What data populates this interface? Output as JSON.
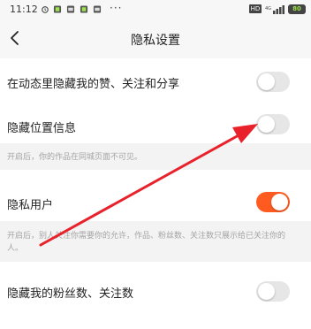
{
  "status_bar": {
    "time": "11:12",
    "more": "···",
    "network": "HD",
    "battery": "80"
  },
  "header": {
    "title": "隐私设置"
  },
  "settings": [
    {
      "label": "在动态里隐藏我的赞、关注和分享",
      "on": false
    },
    {
      "label": "隐藏位置信息",
      "on": false,
      "hint": "开启后，你的作品在同城页面不可见。"
    },
    {
      "label": "隐私用户",
      "on": true,
      "hint": "开启后，别人关注你需要你的允许，作品、粉丝数、关注数只展示给已关注你的人。"
    },
    {
      "label": "隐藏我的粉丝数、关注数",
      "on": false
    }
  ],
  "colors": {
    "accent": "#ff5a1f",
    "annotation_arrow": "#e8212a",
    "toggle_off": "#e6e6e6"
  }
}
